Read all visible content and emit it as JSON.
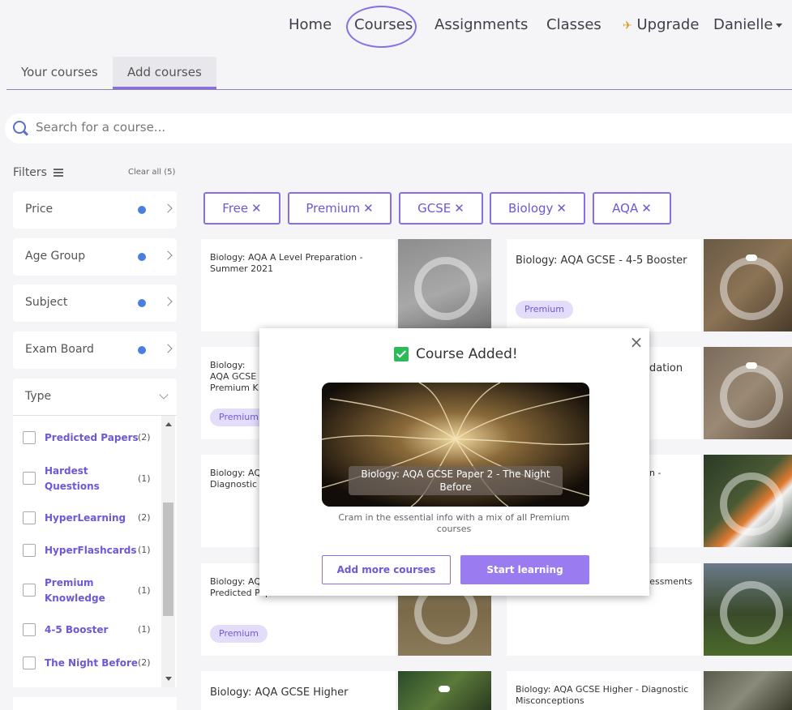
{
  "nav": {
    "home": "Home",
    "courses": "Courses",
    "assignments": "Assignments",
    "classes": "Classes",
    "upgrade": "Upgrade",
    "user": "Danielle"
  },
  "tabs": [
    "Your courses",
    "Add courses"
  ],
  "search": {
    "placeholder": "Search for a course..."
  },
  "filters": {
    "label": "Filters",
    "clear_all": "Clear all (5)",
    "groups": [
      "Price",
      "Age Group",
      "Subject",
      "Exam Board"
    ],
    "type_label": "Type",
    "types": [
      {
        "name": "Predicted Papers",
        "count": "(2)"
      },
      {
        "name": "Hardest Questions",
        "count": "(1)"
      },
      {
        "name": "HyperLearning",
        "count": "(2)"
      },
      {
        "name": "HyperFlashcards",
        "count": "(1)"
      },
      {
        "name": "Premium Knowledge",
        "count": "(1)"
      },
      {
        "name": "4-5 Booster",
        "count": "(1)"
      },
      {
        "name": "The Night Before",
        "count": "(2)"
      }
    ]
  },
  "chips": [
    "Free",
    "Premium",
    "GCSE",
    "Biology",
    "AQA"
  ],
  "courses": [
    {
      "title": "Biology: AQA A Level Preparation - Summer 2021",
      "badge": ""
    },
    {
      "title": "Biology: AQA GCSE - 4-5 Booster",
      "badge": "Premium"
    },
    {
      "title": "Biology: AQA GCSE Premium K",
      "badge": "Premium"
    },
    {
      "title": "dation",
      "badge": ""
    },
    {
      "title": "Biology: AQ Diagnostic",
      "badge": ""
    },
    {
      "title": "n -",
      "badge": ""
    },
    {
      "title": "Biology: AQ Predicted Papers",
      "badge": "Premium"
    },
    {
      "title": "n - Standardised Assessments",
      "badge": ""
    },
    {
      "title": "Biology: AQA GCSE Higher",
      "badge": ""
    },
    {
      "title": "Biology: AQA GCSE Higher - Diagnostic Misconceptions",
      "badge": ""
    }
  ],
  "modal": {
    "title": "Course Added!",
    "close": "×",
    "course_name": "Biology: AQA GCSE Paper 2 - The Night Before",
    "description": "Cram in the essential info with a mix of all Premium courses",
    "add_more": "Add more courses",
    "start": "Start learning"
  },
  "colors": {
    "accent": "#8a6ee8",
    "badge_bg": "#e3ddfa",
    "filter_dot": "#4a7fe0",
    "check": "#2dbb5a"
  }
}
